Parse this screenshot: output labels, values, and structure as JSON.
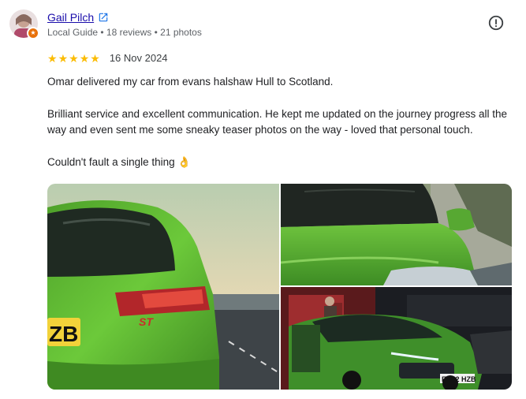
{
  "reviewer": {
    "name": "Gail Pilch",
    "meta": "Local Guide • 18 reviews • 21 photos"
  },
  "rating": {
    "stars": 5,
    "max": 5,
    "date": "16 Nov 2024"
  },
  "review": {
    "paragraphs": [
      "Omar delivered my car from evans halshaw Hull to Scotland.",
      "Brilliant service and excellent communication. He kept me updated on the journey progress all the way and even sent me some sneaky teaser photos on the way - loved that personal touch.",
      "Couldn't fault a single thing 👌"
    ]
  },
  "photos": {
    "plate_rear": "ZB",
    "badge_rear": "ST",
    "plate_front": "EK22 HZB"
  },
  "colors": {
    "star": "#fbbc04",
    "link": "#1a0dab",
    "car_green": "#5cb82e",
    "badge": "#e8710a"
  },
  "icons": {
    "external": "open-in-new-icon",
    "report": "report-icon",
    "local_guide": "local-guide-badge-icon"
  }
}
